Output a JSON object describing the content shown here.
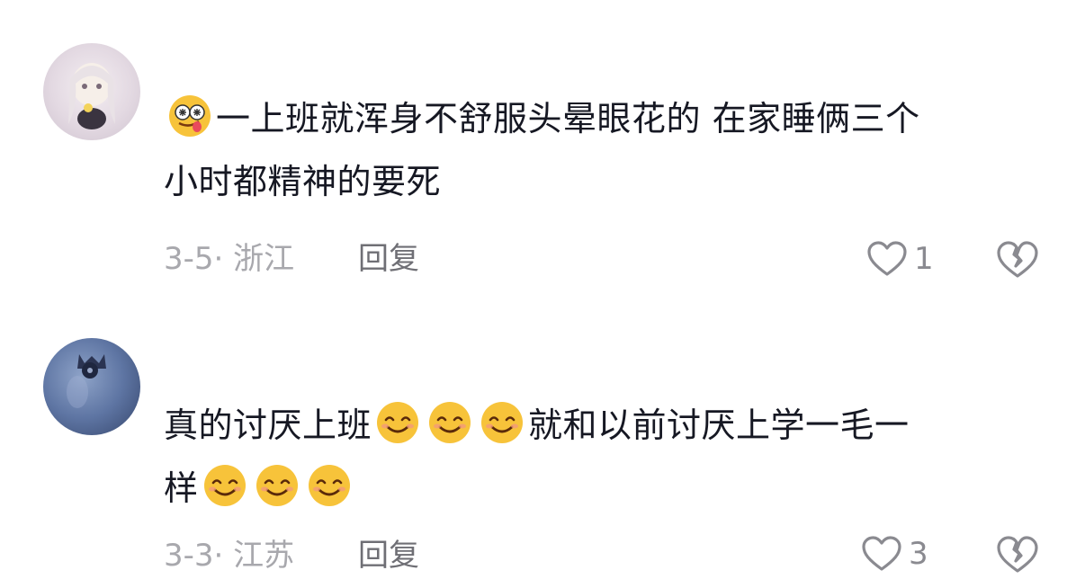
{
  "comments": [
    {
      "avatar": "anime-girl-avatar",
      "lead_emoji": "dizzy-tongue-emoji",
      "text_line1": "一上班就浑身不舒服头晕眼花的 在家睡俩三个",
      "text_line2": "小时都精神的要死",
      "date_location": "3-5· 浙江",
      "reply_label": "回复",
      "like_count": "1"
    },
    {
      "avatar": "blueberry-avatar",
      "text_part1": "真的讨厌上班",
      "text_part2": "就和以前讨厌上学一毛一",
      "text_part3": "样",
      "emoji": "smiling-face-emoji",
      "date_location": "3-3· 江苏",
      "reply_label": "回复",
      "like_count": "3"
    }
  ],
  "colors": {
    "primary_text": "#161823",
    "meta_text": "#a8a8ad",
    "reply_text": "#6f6f75",
    "icon_stroke": "#8a8a90"
  }
}
